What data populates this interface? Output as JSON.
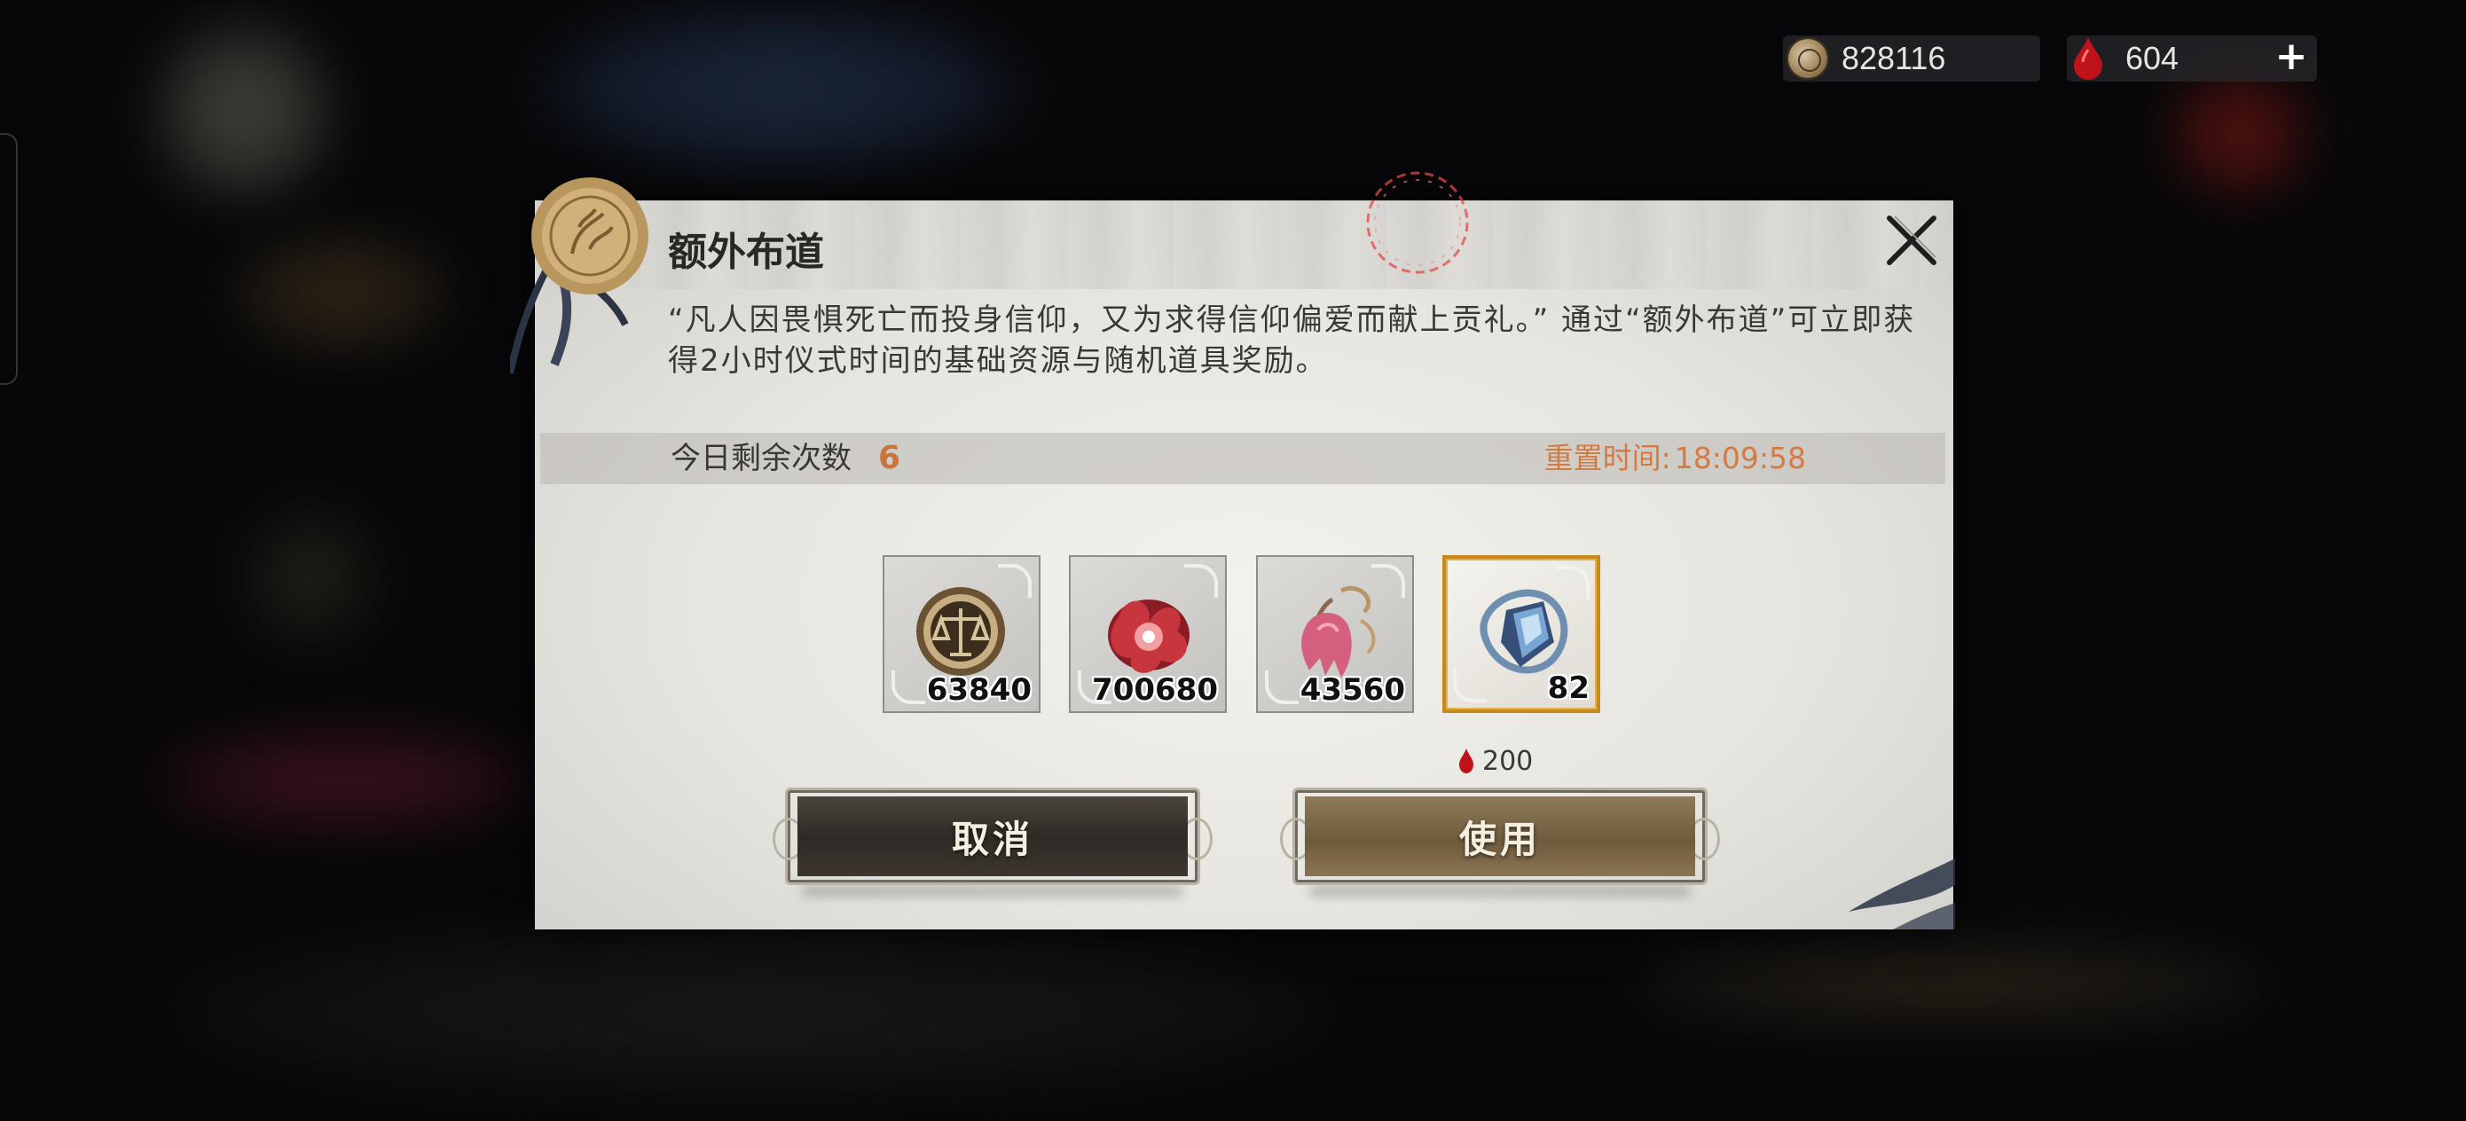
{
  "resources": {
    "coins": "828116",
    "blood": "604",
    "coin_icon": "scales-coin-icon",
    "blood_icon": "blood-drop-icon"
  },
  "dialog": {
    "title": "额外布道",
    "description": "“凡人因畏惧死亡而投身信仰，又为求得信仰偏爱而献上贡礼。” 通过“额外布道”可立即获得2小时仪式时间的基础资源与随机道具奖励。",
    "remaining_label": "今日剩余次数",
    "remaining_count": "6",
    "reset_label": "重置时间:",
    "reset_time": "18:09:58",
    "rewards": [
      {
        "icon": "scales-coin-icon",
        "quantity": "63840"
      },
      {
        "icon": "red-flower-essence-icon",
        "quantity": "700680"
      },
      {
        "icon": "pink-bell-flower-icon",
        "quantity": "43560"
      },
      {
        "icon": "blue-crystal-icon",
        "quantity": "82"
      }
    ],
    "cost": "200",
    "cancel_label": "取消",
    "use_label": "使用"
  },
  "colors": {
    "accent_orange": "#d47b43",
    "gold_border": "#c58a1e",
    "blood_red": "#c0121a"
  }
}
